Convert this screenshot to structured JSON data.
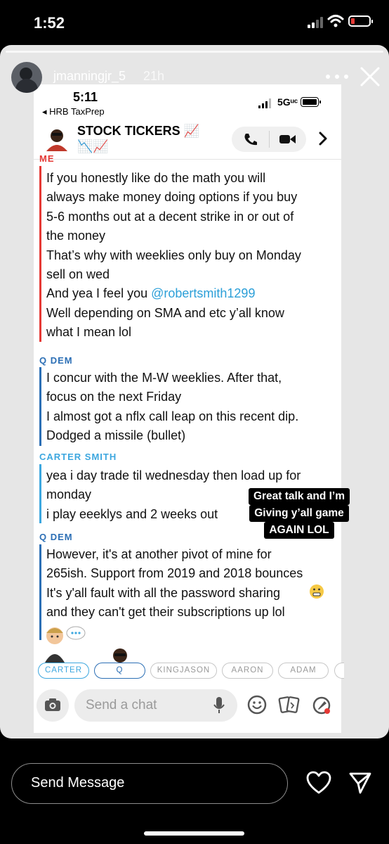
{
  "outer_status": {
    "time": "1:52"
  },
  "story": {
    "username": "jmanningjr_5",
    "age": "21h"
  },
  "inner_status": {
    "time": "5:11",
    "back_app": "◂ HRB TaxPrep",
    "network": "5Gᵘᶜ"
  },
  "chat": {
    "title": "STOCK TICKERS 📈📉📈",
    "messages": [
      {
        "sender": "ME",
        "color": "#e53935",
        "lines": [
          "If you honestly like do the math you will",
          "always make money doing options if you buy",
          "5-6 months out at a decent strike in or out of",
          "the money",
          "That’s why with weeklies only buy on Monday",
          "sell on wed"
        ],
        "mention_prefix": "And yea I feel you ",
        "mention": "@robertsmith1299",
        "lines_after": [
          "Well depending on SMA and etc y’all know",
          "what I mean lol"
        ]
      },
      {
        "sender": "Q DEM",
        "color": "#2c6fb5",
        "lines": [
          "I concur with the M-W weeklies. After that,",
          "focus on the next Friday",
          "I almost got a nflx call leap on this recent dip.",
          "Dodged a missile (bullet)"
        ]
      },
      {
        "sender": "CARTER SMITH",
        "color": "#3da7df",
        "lines": [
          "yea i day trade til wednesday then load up for",
          "monday",
          "i play eeeklys and 2 weeks out"
        ]
      },
      {
        "sender": "Q DEM",
        "color": "#2c6fb5",
        "lines": [
          "However, it's at another pivot of mine for",
          "265ish. Support from 2019 and 2018 bounces",
          "It's y'all fault with all the password sharing",
          "and they can't get their subscriptions up lol"
        ]
      }
    ],
    "chips": [
      "CARTER",
      "Q",
      "KINGJASON",
      "AARON",
      "ADAM"
    ],
    "input_placeholder": "Send a chat"
  },
  "caption": {
    "lines": [
      "Great talk and I’m",
      "Giving y’all game",
      "AGAIN LOL"
    ]
  },
  "reply": {
    "placeholder": "Send Message"
  },
  "icons": {
    "phone": "phone-icon",
    "video": "video-camera-icon",
    "camera": "camera-icon",
    "mic": "microphone-icon",
    "emoji": "smiley-icon",
    "cards": "cards-icon",
    "rocket": "rocket-icon",
    "heart": "heart-icon",
    "send": "send-arrow-icon"
  },
  "colors": {
    "me": "#e53935",
    "q": "#2c6fb5",
    "carter": "#3da7df",
    "mention": "#2b9fd8"
  }
}
